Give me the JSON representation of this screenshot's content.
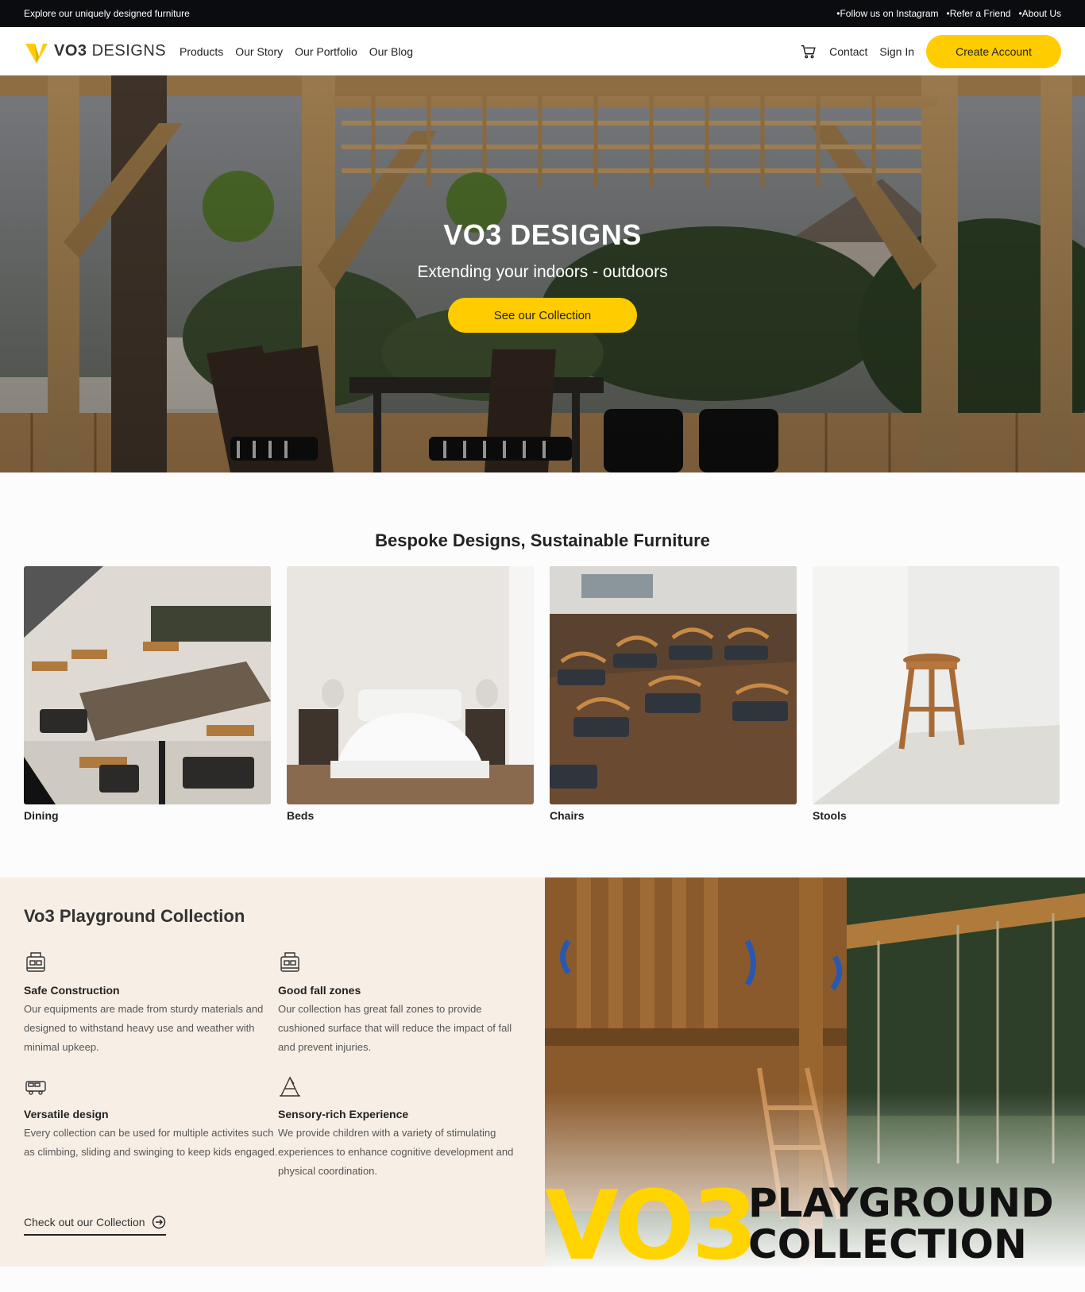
{
  "topbar": {
    "promo": "Explore our uniquely designed furniture",
    "links": [
      "Follow us on Instagram",
      "Refer a Friend",
      "About Us"
    ]
  },
  "header": {
    "logo_bold": "VO3",
    "logo_light": "DESIGNS",
    "nav": [
      "Products",
      "Our Story",
      "Our Portfolio",
      "Our Blog"
    ],
    "contact": "Contact",
    "sign_in": "Sign In",
    "create_account": "Create Account"
  },
  "hero": {
    "title": "VO3 DESIGNS",
    "subtitle": "Extending your indoors - outdoors",
    "cta": "See our Collection"
  },
  "categories": {
    "title": "Bespoke Designs, Sustainable Furniture",
    "items": [
      {
        "label": "Dining"
      },
      {
        "label": "Beds"
      },
      {
        "label": "Chairs"
      },
      {
        "label": "Stools"
      }
    ]
  },
  "playground": {
    "title": "Vo3 Playground Collection",
    "features": [
      {
        "icon": "playset-icon",
        "title": "Safe Construction",
        "text": "Our equipments are made from sturdy materials and designed to withstand heavy use and weather with minimal upkeep."
      },
      {
        "icon": "playset-icon",
        "title": "Good fall zones",
        "text": "Our collection has great fall zones to provide cushioned surface that will reduce the impact of fall and prevent injuries."
      },
      {
        "icon": "vehicle-icon",
        "title": "Versatile design",
        "text": "Every collection can be used for multiple activites such as climbing, sliding and swinging to keep kids engaged."
      },
      {
        "icon": "swing-icon",
        "title": "Sensory-rich Experience",
        "text": "We provide children with a variety of stimulating experiences to enhance cognitive development and physical coordination."
      }
    ],
    "link": "Check out our Collection",
    "banner_vo3": "VO3",
    "banner_line1": "PLAYGROUND",
    "banner_line2": "COLLECTION"
  },
  "colors": {
    "accent": "#ffcc00",
    "topbar_bg": "#0b0c0f",
    "playground_bg": "#f7efe6"
  }
}
